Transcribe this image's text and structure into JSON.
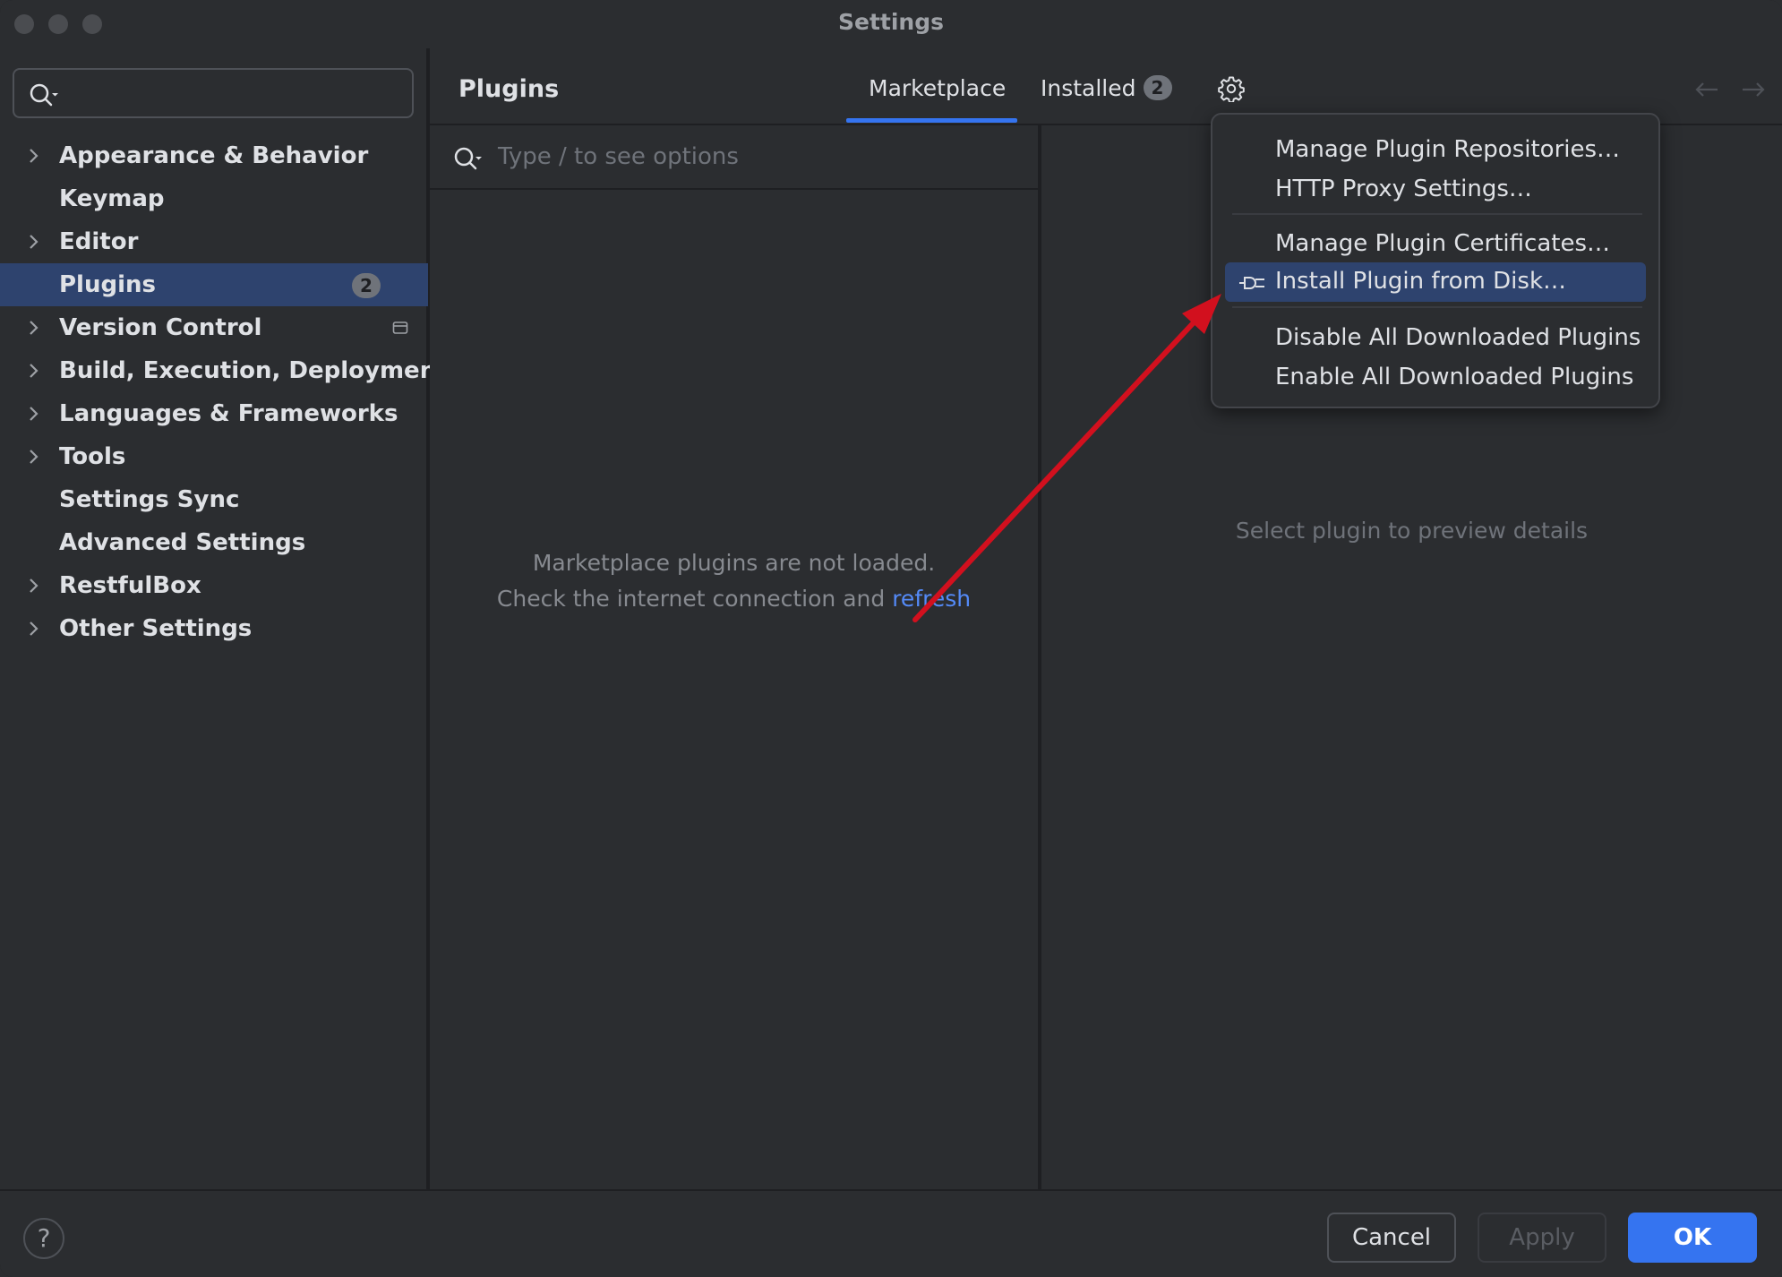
{
  "window": {
    "title": "Settings"
  },
  "sidebar": {
    "search_placeholder": "",
    "items": [
      {
        "label": "Appearance & Behavior",
        "expandable": true
      },
      {
        "label": "Keymap",
        "expandable": false
      },
      {
        "label": "Editor",
        "expandable": true
      },
      {
        "label": "Plugins",
        "expandable": false,
        "selected": true,
        "badge": "2"
      },
      {
        "label": "Version Control",
        "expandable": true
      },
      {
        "label": "Build, Execution, Deployment",
        "expandable": true
      },
      {
        "label": "Languages & Frameworks",
        "expandable": true
      },
      {
        "label": "Tools",
        "expandable": true
      },
      {
        "label": "Settings Sync",
        "expandable": false
      },
      {
        "label": "Advanced Settings",
        "expandable": false
      },
      {
        "label": "RestfulBox",
        "expandable": true
      },
      {
        "label": "Other Settings",
        "expandable": true
      }
    ]
  },
  "header": {
    "title": "Plugins",
    "tabs": [
      {
        "label": "Marketplace",
        "active": true
      },
      {
        "label": "Installed",
        "badge": "2"
      }
    ],
    "icons": {
      "settings": "gear-icon",
      "back": "arrow-left-icon",
      "forward": "arrow-right-icon"
    }
  },
  "plugin_list": {
    "search_placeholder": "Type / to see options",
    "empty_line1": "Marketplace plugins are not loaded.",
    "empty_line2": "Check the internet connection and ",
    "refresh_link": "refresh"
  },
  "detail": {
    "placeholder": "Select plugin to preview details"
  },
  "menu": {
    "items": [
      {
        "label": "Manage Plugin Repositories…"
      },
      {
        "label": "HTTP Proxy Settings…"
      },
      {
        "label": "Manage Plugin Certificates…"
      },
      {
        "label": "Install Plugin from Disk…",
        "highlighted": true,
        "icon": "plug-icon"
      },
      {
        "label": "Disable All Downloaded Plugins"
      },
      {
        "label": "Enable All Downloaded Plugins"
      }
    ]
  },
  "footer": {
    "help_label": "?",
    "cancel_label": "Cancel",
    "apply_label": "Apply",
    "ok_label": "OK"
  },
  "colors": {
    "accent": "#3574f0",
    "selection": "#2e436e",
    "link": "#548af7",
    "annotation_arrow": "#d2101e"
  }
}
